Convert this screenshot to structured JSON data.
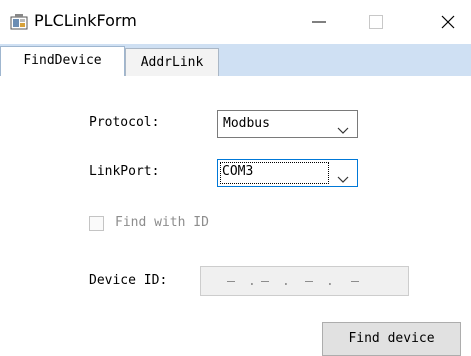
{
  "window": {
    "title": "PLCLinkForm"
  },
  "tabs": [
    {
      "label": "FindDevice",
      "active": true
    },
    {
      "label": "AddrLink",
      "active": false
    }
  ],
  "form": {
    "protocol_label": "Protocol:",
    "protocol_value": "Modbus",
    "linkport_label": "LinkPort:",
    "linkport_value": "COM3",
    "find_with_id_label": "Find with ID",
    "find_with_id_checked": false,
    "device_id_label": "Device ID:",
    "device_id_dots": [
      ".",
      ".",
      "."
    ],
    "find_button_label": "Find device"
  },
  "colors": {
    "tabstrip": "#cfe0f3",
    "focus_border": "#0078d7",
    "disabled_text": "#8d8d8d",
    "button_face": "#e1e1e1"
  },
  "icons": {
    "app": "plc-app-icon",
    "minimize": "minimize-icon",
    "maximize": "maximize-icon",
    "close": "close-icon",
    "dropdown": "chevron-down-icon"
  }
}
